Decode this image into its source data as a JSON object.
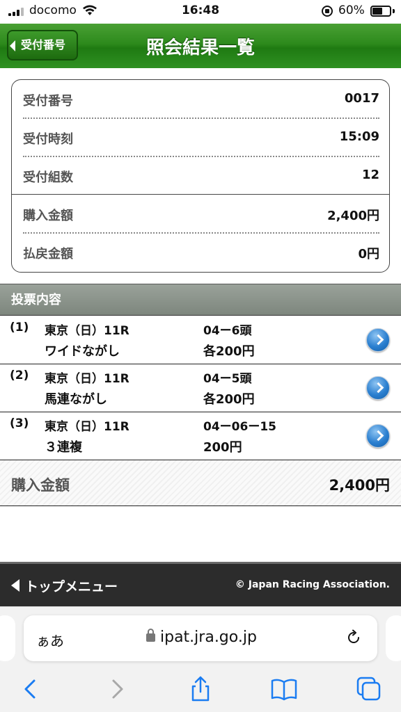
{
  "status_bar": {
    "carrier": "docomo",
    "time": "16:48",
    "battery_pct": "60%",
    "battery_level": 0.6
  },
  "header": {
    "back_label": "受付番号",
    "title": "照会結果一覧",
    "color": "#2d8a1c"
  },
  "summary": {
    "rows": [
      {
        "label": "受付番号",
        "value": "0017"
      },
      {
        "label": "受付時刻",
        "value": "15:09"
      },
      {
        "label": "受付組数",
        "value": "12"
      },
      {
        "label": "購入金額",
        "value": "2,400円"
      },
      {
        "label": "払戻金額",
        "value": "0円"
      }
    ]
  },
  "bets_section": {
    "title": "投票内容",
    "items": [
      {
        "num": "(1)",
        "race": "東京（日）11R",
        "type": "ワイドながし",
        "horses": "04ー6頭",
        "amount": "各200円"
      },
      {
        "num": "(2)",
        "race": "東京（日）11R",
        "type": "馬連ながし",
        "horses": "04ー5頭",
        "amount": "各200円"
      },
      {
        "num": "(3)",
        "race": "東京（日）11R",
        "type": "３連複",
        "horses": "04ー06ー15",
        "amount": "200円"
      }
    ]
  },
  "total": {
    "label": "購入金額",
    "value": "2,400円"
  },
  "footer": {
    "top_menu": "トップメニュー",
    "copyright": "© Japan Racing Association."
  },
  "browser": {
    "aa_label": "ぁあ",
    "url": "ipat.jra.go.jp",
    "accent_color": "#1a7cf2"
  }
}
